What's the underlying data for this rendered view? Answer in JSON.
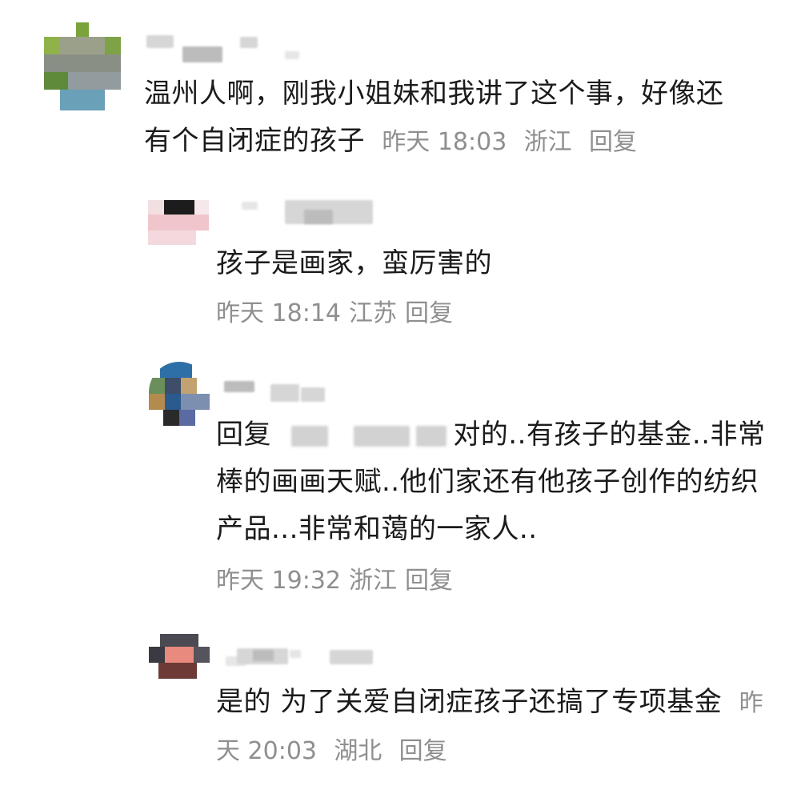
{
  "comments": [
    {
      "text": "温州人啊，刚我小姐妹和我讲了这个事，好像还有个自闭症的孩子",
      "time": "昨天 18:03",
      "location": "浙江",
      "reply_label": "回复"
    },
    {
      "text": "孩子是画家，蛮厉害的",
      "time": "昨天 18:14",
      "location": "江苏",
      "reply_label": "回复"
    },
    {
      "reply_prefix": "回复",
      "text": "对的..有孩子的基金..非常棒的画画天赋..他们家还有他孩子创作的纺织产品...非常和蔼的一家人..",
      "time": "昨天 19:32",
      "location": "浙江",
      "reply_label": "回复"
    },
    {
      "text": "是的 为了关爱自闭症孩子还搞了专项基金",
      "time": "昨天 20:03",
      "location": "湖北",
      "reply_label": "回复"
    }
  ]
}
